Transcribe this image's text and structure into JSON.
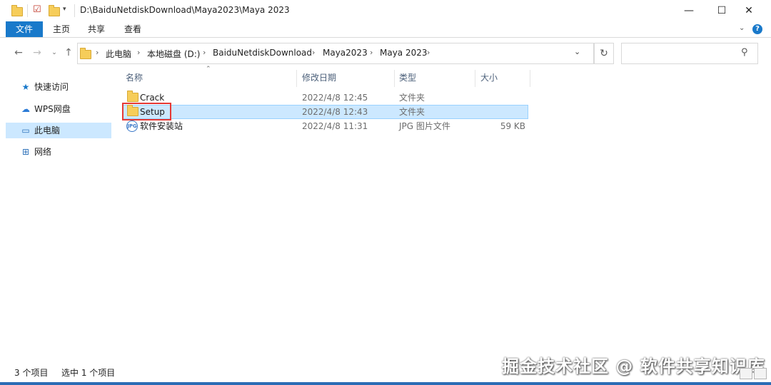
{
  "title": {
    "path": "D:\\BaiduNetdiskDownload\\Maya2023\\Maya 2023"
  },
  "window_controls": {
    "minimize": "—",
    "maximize": "☐",
    "close": "✕"
  },
  "ribbon": {
    "tabs": [
      "文件",
      "主页",
      "共享",
      "查看"
    ],
    "help": "?"
  },
  "breadcrumb": [
    "此电脑",
    "本地磁盘 (D:)",
    "BaiduNetdiskDownload",
    "Maya2023",
    "Maya 2023"
  ],
  "nav": [
    {
      "label": "快速访问",
      "icon": "star-icon"
    },
    {
      "label": "WPS网盘",
      "icon": "cloud-icon"
    },
    {
      "label": "此电脑",
      "icon": "computer-icon",
      "selected": true
    },
    {
      "label": "网络",
      "icon": "network-icon"
    }
  ],
  "columns": {
    "name": "名称",
    "date": "修改日期",
    "type": "类型",
    "size": "大小"
  },
  "files": [
    {
      "name": "Crack",
      "date": "2022/4/8 12:45",
      "type": "文件夹",
      "size": "",
      "icon": "folder-icon"
    },
    {
      "name": "Setup",
      "date": "2022/4/8 12:43",
      "type": "文件夹",
      "size": "",
      "icon": "folder-icon",
      "selected": true
    },
    {
      "name": "软件安装站",
      "date": "2022/4/8 11:31",
      "type": "JPG 图片文件",
      "size": "59 KB",
      "icon": "jpg-icon"
    }
  ],
  "status": {
    "count": "3 个项目",
    "selected": "选中 1 个项目"
  },
  "watermark": "掘金技术社区 @ 软件共享知识库",
  "colors": {
    "accent": "#1979ca",
    "selection": "#cce8ff",
    "highlight": "#e53935"
  }
}
